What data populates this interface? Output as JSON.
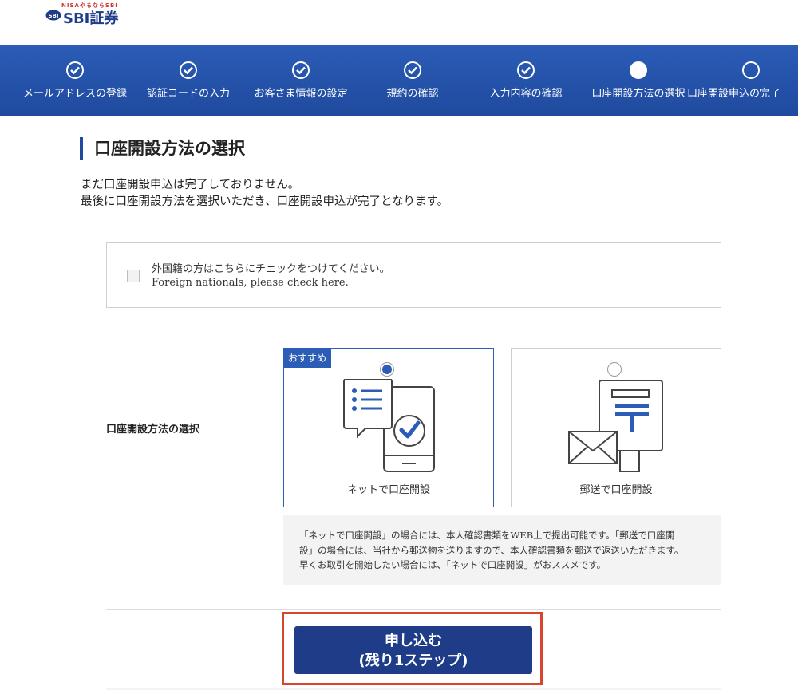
{
  "logo": {
    "tagline": "NISAやるならSBI",
    "brand": "SBI証券"
  },
  "progress": {
    "steps": [
      {
        "label": "メールアドレスの登録",
        "state": "done"
      },
      {
        "label": "認証コードの入力",
        "state": "done"
      },
      {
        "label": "お客さま情報の設定",
        "state": "done"
      },
      {
        "label": "規約の確認",
        "state": "done"
      },
      {
        "label": "入力内容の確認",
        "state": "done"
      },
      {
        "label": "口座開設方法の選択",
        "state": "current"
      },
      {
        "label": "口座開設申込の完了",
        "state": "todo"
      }
    ]
  },
  "heading": "口座開設方法の選択",
  "intro": {
    "line1": "まだ口座開設申込は完了しておりません。",
    "line2": "最後に口座開設方法を選択いただき、口座開設申込が完了となります。"
  },
  "foreign": {
    "checked": false,
    "text_ja": "外国籍の方はこちらにチェックをつけてください。",
    "text_en": "Foreign nationals, please check here."
  },
  "method": {
    "label": "口座開設方法の選択",
    "options": [
      {
        "badge": "おすすめ",
        "caption": "ネットで口座開設",
        "selected": true
      },
      {
        "badge": "",
        "caption": "郵送で口座開設",
        "selected": false
      }
    ],
    "note_line1": "「ネットで口座開設」の場合には、本人確認書類をWEB上で提出可能です。「郵送で口座開",
    "note_line2": "設」の場合には、当社から郵送物を送りますので、本人確認書類を郵送で返送いただきます。",
    "note_line3": "早くお取引を開始したい場合には、「ネットで口座開設」がおススメです。"
  },
  "submit": {
    "line1": "申し込む",
    "line2": "(残り1ステップ)"
  },
  "colors": {
    "primary": "#1f3c88",
    "progress": "#2b5cb6",
    "highlight": "#d8452e"
  }
}
